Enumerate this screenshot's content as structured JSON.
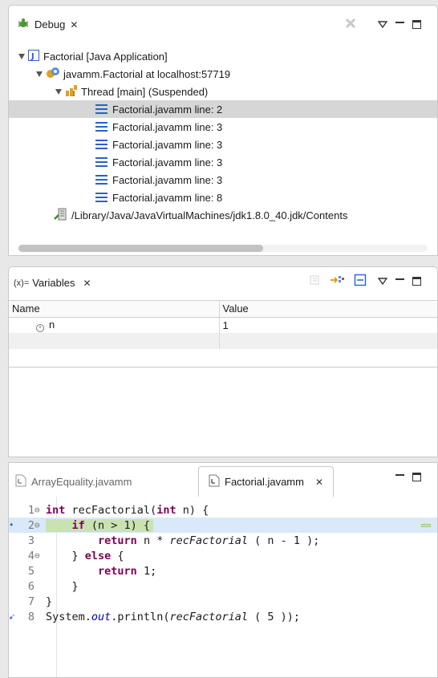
{
  "debug": {
    "tab_label": "Debug",
    "tree": [
      {
        "label": "Factorial [Java Application]"
      },
      {
        "label": "javamm.Factorial at localhost:57719"
      },
      {
        "label": "Thread [main] (Suspended)"
      },
      {
        "label": "Factorial.javamm line: 2"
      },
      {
        "label": "Factorial.javamm line: 3"
      },
      {
        "label": "Factorial.javamm line: 3"
      },
      {
        "label": "Factorial.javamm line: 3"
      },
      {
        "label": "Factorial.javamm line: 3"
      },
      {
        "label": "Factorial.javamm line: 8"
      },
      {
        "label": "/Library/Java/JavaVirtualMachines/jdk1.8.0_40.jdk/Contents"
      }
    ]
  },
  "variables": {
    "tab_prefix": "(x)=",
    "tab_label": "Variables",
    "col_name": "Name",
    "col_value": "Value",
    "rows": [
      {
        "name": "n",
        "value": "1"
      }
    ]
  },
  "editor": {
    "tabs": [
      {
        "label": "ArrayEquality.javamm"
      },
      {
        "label": "Factorial.javamm"
      }
    ],
    "line_numbers": [
      "1",
      "2",
      "3",
      "4",
      "5",
      "6",
      "7",
      "8"
    ]
  },
  "colors": {
    "current_line_bg": "#d9e9f9",
    "breakpoint_line_bg": "#c9e3b0",
    "keyword": "#7f0055"
  }
}
